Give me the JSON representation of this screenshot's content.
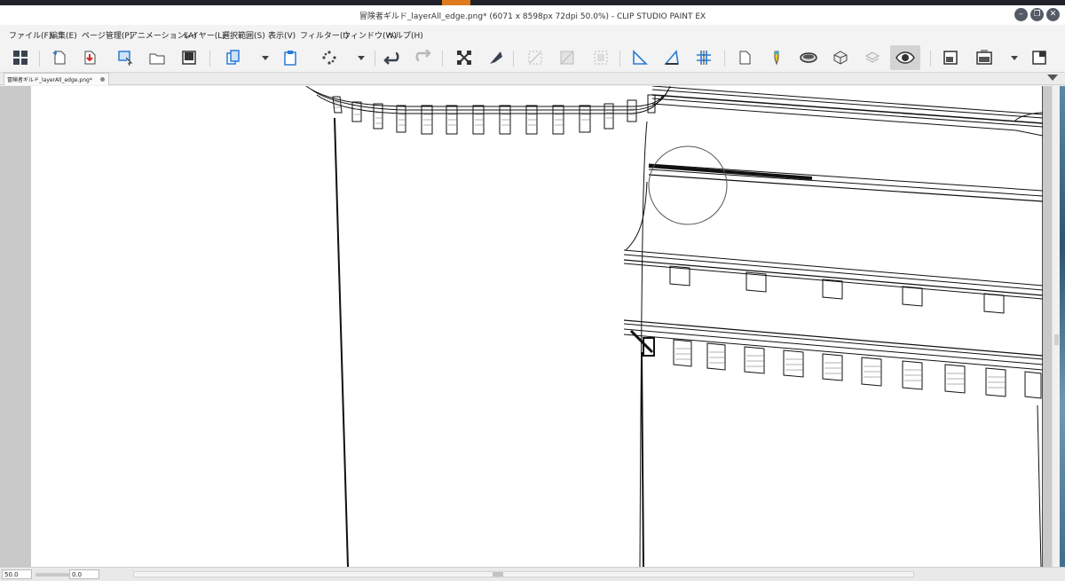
{
  "window": {
    "title": "冒険者ギルド_layerAll_edge.png* (6071 x 8598px 72dpi 50.0%) - CLIP STUDIO PAINT EX",
    "controls": {
      "minimize": "–",
      "restore": "❐",
      "close": "✕"
    }
  },
  "menubar": {
    "items": [
      "ファイル(F)",
      "編集(E)",
      "ページ管理(P)",
      "アニメーション(A)",
      "レイヤー(L)",
      "選択範囲(S)",
      "表示(V)",
      "フィルター(I)",
      "ウィンドウ(W)",
      "ヘルプ(H)"
    ]
  },
  "toolbar": {
    "icons": [
      "app-grid-icon",
      "new-file-icon",
      "import-icon",
      "select-window-icon",
      "open-folder-icon",
      "save-icon",
      "copy-icon",
      "dropdown-icon",
      "paste-icon",
      "scatter-icon",
      "dropdown-icon",
      "undo-icon",
      "redo-icon",
      "transform-icon",
      "pen-icon",
      "ruler-off-icon",
      "fill-icon",
      "selection-off-icon",
      "perspective-ruler-icon",
      "ruler-icon",
      "grid-ruler-icon",
      "new-page-icon",
      "marker-icon",
      "ellipse-icon",
      "3d-icon",
      "layers-icon",
      "eye-icon",
      "navigator-icon",
      "frame-icon",
      "dropdown-icon",
      "panel-icon"
    ]
  },
  "tab": {
    "label": "冒険者ギルド_layerAll_edge.png*"
  },
  "status": {
    "zoom": "50.0",
    "angle": "0.0"
  },
  "colors": {
    "accent_orange": "#e07a1f",
    "window_bg": "#f0f0f0",
    "canvas_bg": "#c9c9c9",
    "page_bg": "#ffffff",
    "line_art": "#111111"
  }
}
